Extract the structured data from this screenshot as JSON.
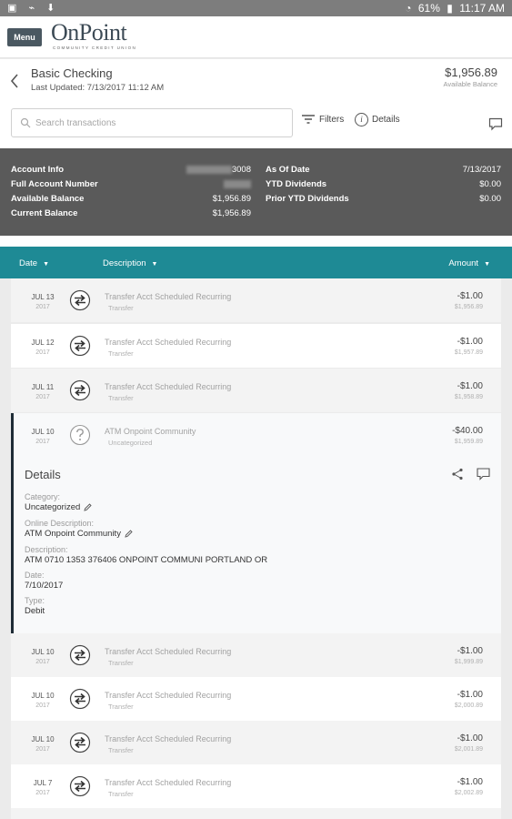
{
  "status_bar": {
    "battery": "61%",
    "time": "11:17 AM"
  },
  "app": {
    "menu_label": "Menu",
    "logo_text": "OnPoint",
    "logo_subtext": "COMMUNITY CREDIT UNION"
  },
  "account": {
    "name": "Basic Checking",
    "last_updated": "Last Updated: 7/13/2017 11:12 AM",
    "balance": "$1,956.89",
    "balance_label": "Available Balance"
  },
  "toolbar": {
    "search_placeholder": "Search transactions",
    "filters_label": "Filters",
    "details_label": "Details"
  },
  "account_info": {
    "left": [
      {
        "label": "Account Info",
        "value": "3008"
      },
      {
        "label": "Full Account Number",
        "value": ""
      },
      {
        "label": "Available Balance",
        "value": "$1,956.89"
      },
      {
        "label": "Current Balance",
        "value": "$1,956.89"
      }
    ],
    "right": [
      {
        "label": "As Of Date",
        "value": "7/13/2017"
      },
      {
        "label": "YTD Dividends",
        "value": "$0.00"
      },
      {
        "label": "Prior YTD Dividends",
        "value": "$0.00"
      }
    ]
  },
  "table_headers": {
    "date": "Date",
    "description": "Description",
    "amount": "Amount"
  },
  "transactions": [
    {
      "month_day": "JUL 13",
      "year": "2017",
      "icon": "transfer-icon",
      "description": "Transfer Acct Scheduled Recurring",
      "category": "Transfer",
      "amount": "-$1.00",
      "balance": "$1,956.89"
    },
    {
      "month_day": "JUL 12",
      "year": "2017",
      "icon": "transfer-icon",
      "description": "Transfer Acct Scheduled Recurring",
      "category": "Transfer",
      "amount": "-$1.00",
      "balance": "$1,957.89"
    },
    {
      "month_day": "JUL 11",
      "year": "2017",
      "icon": "transfer-icon",
      "description": "Transfer Acct Scheduled Recurring",
      "category": "Transfer",
      "amount": "-$1.00",
      "balance": "$1,958.89"
    },
    {
      "month_day": "JUL 10",
      "year": "2017",
      "icon": "question-icon",
      "description": "ATM Onpoint Community",
      "category": "Uncategorized",
      "amount": "-$40.00",
      "balance": "$1,959.89"
    },
    {
      "month_day": "JUL 10",
      "year": "2017",
      "icon": "transfer-icon",
      "description": "Transfer Acct Scheduled Recurring",
      "category": "Transfer",
      "amount": "-$1.00",
      "balance": "$1,999.89"
    },
    {
      "month_day": "JUL 10",
      "year": "2017",
      "icon": "transfer-icon",
      "description": "Transfer Acct Scheduled Recurring",
      "category": "Transfer",
      "amount": "-$1.00",
      "balance": "$2,000.89"
    },
    {
      "month_day": "JUL 10",
      "year": "2017",
      "icon": "transfer-icon",
      "description": "Transfer Acct Scheduled Recurring",
      "category": "Transfer",
      "amount": "-$1.00",
      "balance": "$2,001.89"
    },
    {
      "month_day": "JUL 7",
      "year": "2017",
      "icon": "transfer-icon",
      "description": "Transfer Acct Scheduled Recurring",
      "category": "Transfer",
      "amount": "-$1.00",
      "balance": "$2,002.89"
    }
  ],
  "details": {
    "title": "Details",
    "category_label": "Category:",
    "category_value": "Uncategorized",
    "online_description_label": "Online Description:",
    "online_description_value": "ATM Onpoint Community",
    "description_label": "Description:",
    "description_value": "ATM 0710 1353 376406 ONPOINT COMMUNI PORTLAND OR",
    "date_label": "Date:",
    "date_value": "7/10/2017",
    "type_label": "Type:",
    "type_value": "Debit"
  }
}
